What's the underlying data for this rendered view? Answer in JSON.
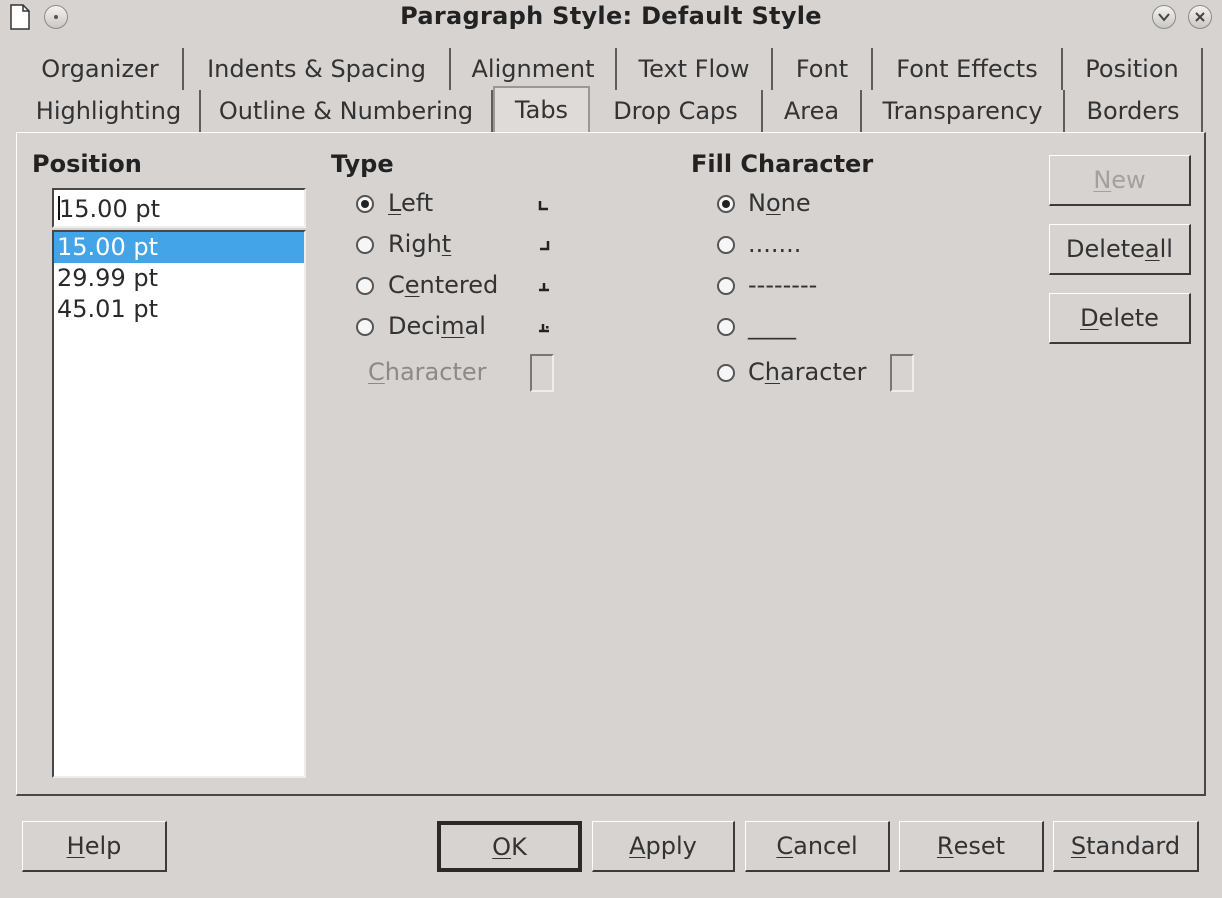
{
  "window": {
    "title": "Paragraph Style: Default Style",
    "icons": [
      "document-icon",
      "menu-circle-icon",
      "chevron-down-icon",
      "close-icon"
    ]
  },
  "tabs_row1": [
    "Organizer",
    "Indents & Spacing",
    "Alignment",
    "Text Flow",
    "Font",
    "Font Effects",
    "Position"
  ],
  "tabs_row2": [
    "Highlighting",
    "Outline & Numbering",
    "Tabs",
    "Drop Caps",
    "Area",
    "Transparency",
    "Borders"
  ],
  "active_tab": "Tabs",
  "position": {
    "heading": "Position",
    "input_value": "15.00 pt",
    "items": [
      "15.00 pt",
      "29.99 pt",
      "45.01 pt"
    ],
    "selected": "15.00 pt"
  },
  "type": {
    "heading": "Type",
    "options": [
      {
        "label": "Left",
        "selected": true
      },
      {
        "label": "Right",
        "selected": false
      },
      {
        "label": "Centered",
        "selected": false
      },
      {
        "label": "Decimal",
        "selected": false
      }
    ],
    "character_label": "Character"
  },
  "fill": {
    "heading": "Fill Character",
    "options": [
      {
        "label": "None",
        "selected": true
      },
      {
        "label": ".......",
        "selected": false
      },
      {
        "label": "--------",
        "selected": false
      },
      {
        "label": "____",
        "selected": false
      }
    ],
    "character_label": "Character"
  },
  "side_buttons": {
    "new": "New",
    "delete_all": "Delete all",
    "delete": "Delete"
  },
  "footer": {
    "help": "Help",
    "ok": "OK",
    "apply": "Apply",
    "cancel": "Cancel",
    "reset": "Reset",
    "standard": "Standard"
  },
  "colors": {
    "background": "#d6d3d0",
    "selection": "#43a4e8"
  }
}
